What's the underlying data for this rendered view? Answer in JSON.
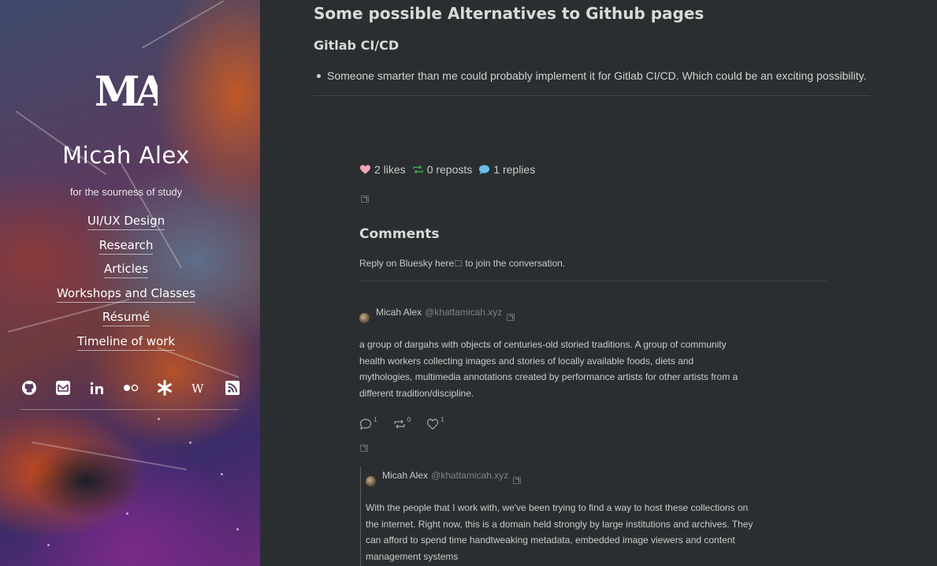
{
  "sidebar": {
    "title": "Micah Alex",
    "tagline": "for the sourness of study",
    "nav": [
      {
        "label": "UI/UX Design"
      },
      {
        "label": "Research"
      },
      {
        "label": "Articles"
      },
      {
        "label": "Workshops and Classes"
      },
      {
        "label": "Résumé"
      },
      {
        "label": "Timeline of work"
      }
    ],
    "social_icons": [
      "github-icon",
      "mail-icon",
      "linkedin-icon",
      "flickr-icon",
      "asterisk-icon",
      "wikipedia-icon",
      "rss-icon"
    ],
    "wiki_glyph": "W"
  },
  "article": {
    "heading": "Some possible Alternatives to Github pages",
    "subheading": "Gitlab CI/CD",
    "bullet": "Someone smarter than me could probably implement it for Gitlab CI/CD. Which could be an exciting possibility."
  },
  "stats": {
    "likes": "2 likes",
    "reposts": "0 reposts",
    "replies": "1 replies"
  },
  "comments": {
    "title": "Comments",
    "reply_prefix": "Reply on Bluesky here",
    "reply_suffix": " to join the conversation.",
    "posts": [
      {
        "author": "Micah Alex",
        "handle": "@khattamicah.xyz",
        "lines": [
          "a group of dargahs with objects of centuries-old storied traditions. A group of community",
          "health workers collecting images and stories of locally available foods, diets and",
          "mythologies, multimedia annotations created by performance artists for other artists from a",
          "different tradition/discipline."
        ],
        "reply_count": "1",
        "repost_count": "0",
        "like_count": "1"
      },
      {
        "author": "Micah Alex",
        "handle": "@khattamicah.xyz",
        "lines": [
          "With the people that I work with, we've been trying to find a way to host these collections on",
          "the internet. Right now, this is a domain held strongly by large institutions and archives. They",
          "can afford to spend time handtweaking metadata, embedded image viewers and content",
          "management systems"
        ]
      }
    ]
  },
  "colors": {
    "background": "#2b2e31",
    "text": "#d8d9d6",
    "handle": "#7f8386",
    "like": "#f5a3b5",
    "repost": "#3aa84a",
    "reply": "#6cc0e8"
  }
}
